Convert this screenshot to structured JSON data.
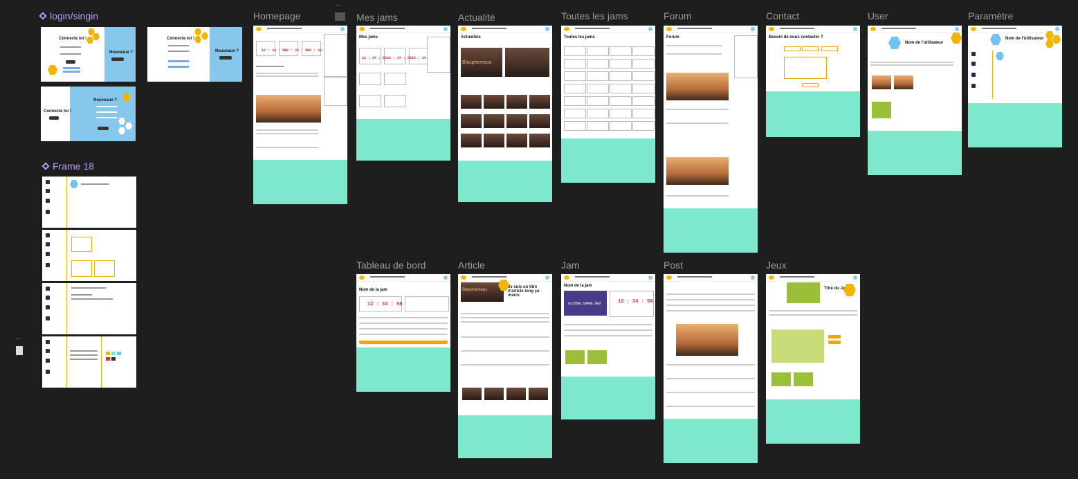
{
  "canvas": {
    "components": [
      {
        "label": "login/singin"
      },
      {
        "label": "Frame 18"
      }
    ],
    "frames": {
      "homepage": "Homepage",
      "mes_jams": "Mes jams",
      "actualite": "Actualité",
      "toutes_jams": "Toutes les jams",
      "forum": "Forum",
      "contact": "Contact",
      "user": "User",
      "parametre": "Paramètre",
      "tableau_de_bord": "Tableau de bord",
      "article": "Article",
      "jam": "Jam",
      "post": "Post",
      "jeux": "Jeux"
    },
    "login": {
      "connecte_toi": "Connecte toi !",
      "nouveaux": "Nouveaux ?"
    },
    "frame_contents": {
      "timer": "12 : 34 : 56",
      "timer_small": "12 : 34 : 56",
      "mes_jams_title": "Mes jams",
      "actualite_title": "Actualités",
      "toutes_title": "Toutes les jams",
      "forum_title": "Forum",
      "contact_title": "Besoin de nous contacter ?",
      "user_name": "Nom de l'utilisateur",
      "param_name": "Nom de l'utilisateur",
      "tdb_jam_name": "Nom de la jam",
      "article_heading": "Je suis un titre d'article long ça marre",
      "jam_title": "Nom de la jam",
      "jeux_title": "Titre du Jeu",
      "blasphemous": "Blasphemous",
      "ggj": "GLOBAL GAME JAM"
    },
    "colors": {
      "background": "#1e1e1e",
      "footer": "#7ee8cc",
      "accent": "#f4b400",
      "login_blue": "#86c8ec",
      "component_label": "#b99cf5"
    }
  }
}
